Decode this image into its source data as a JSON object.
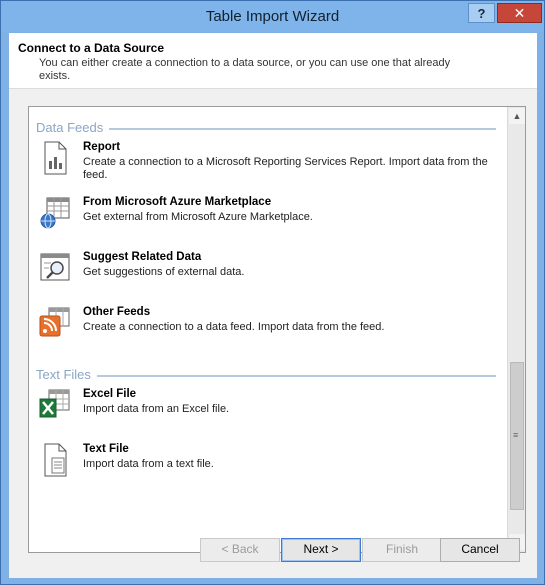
{
  "window": {
    "title": "Table Import Wizard",
    "help_label": "?",
    "close_label": "✕"
  },
  "header": {
    "title": "Connect to a Data Source",
    "description": "You can either create a connection to a data source, or you can use one that already exists."
  },
  "groups": [
    {
      "label": "Data Feeds",
      "items": [
        {
          "icon": "report-icon",
          "title": "Report",
          "description": "Create a connection to a Microsoft Reporting Services Report. Import data from the feed."
        },
        {
          "icon": "azure-marketplace-icon",
          "title": "From Microsoft Azure Marketplace",
          "description": "Get external from Microsoft Azure Marketplace."
        },
        {
          "icon": "suggest-related-data-icon",
          "title": "Suggest Related Data",
          "description": "Get suggestions of external data."
        },
        {
          "icon": "other-feeds-icon",
          "title": "Other Feeds",
          "description": "Create a connection to a data feed. Import data from the feed."
        }
      ]
    },
    {
      "label": "Text Files",
      "items": [
        {
          "icon": "excel-file-icon",
          "title": "Excel File",
          "description": "Import data from an Excel file."
        },
        {
          "icon": "text-file-icon",
          "title": "Text File",
          "description": "Import data from a text file."
        }
      ]
    }
  ],
  "buttons": {
    "back": "< Back",
    "next": "Next >",
    "finish": "Finish",
    "cancel": "Cancel"
  },
  "scrollbar": {
    "up_icon": "▲",
    "down_icon": "▼",
    "grip_icon": "≡"
  }
}
